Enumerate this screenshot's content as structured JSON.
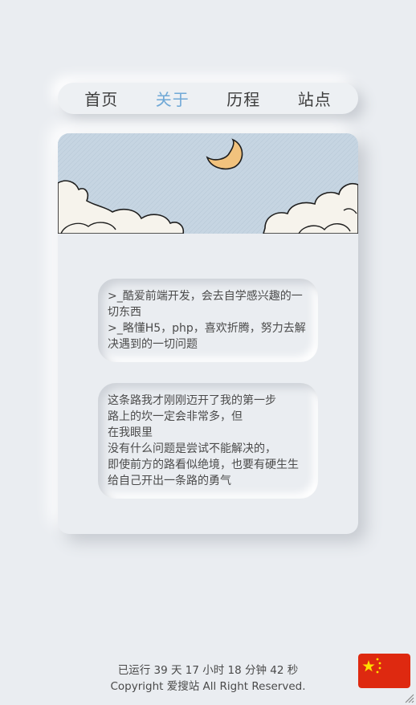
{
  "nav": {
    "items": [
      {
        "label": "首页",
        "active": false
      },
      {
        "label": "关于",
        "active": true
      },
      {
        "label": "历程",
        "active": false
      },
      {
        "label": "站点",
        "active": false
      }
    ]
  },
  "about": {
    "intro": ">_酷爱前端开发，会去自学感兴趣的一切东西\n>_略懂H5，php，喜欢折腾，努力去解决遇到的一切问题",
    "motto": "这条路我才刚刚迈开了我的第一步\n路上的坎一定会非常多，但\n在我眼里\n没有什么问题是尝试不能解决的，\n即使前方的路看似绝境，也要有硬生生给自己开出一条路的勇气"
  },
  "footer": {
    "runtime": "已运行 39 天 17 小时 18 分钟 42 秒",
    "copyright": "Copyright 爱搜站 All Right Reserved."
  },
  "colors": {
    "background": "#eaedf1",
    "nav_active": "#6fa8d6",
    "sky": "#c5d4e1",
    "moon": "#f1c27d",
    "flag_red": "#de2910",
    "flag_star": "#ffde00"
  },
  "icons": {
    "flag": "china-flag-icon",
    "moon": "crescent-moon-icon",
    "resize": "resize-handle-icon"
  }
}
